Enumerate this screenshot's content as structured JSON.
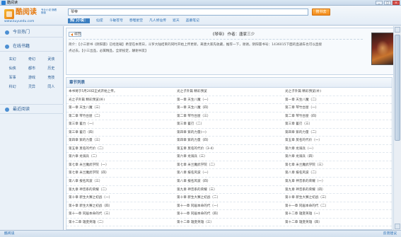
{
  "window": {
    "title": "酷阅读",
    "min": "_",
    "max": "□",
    "close": "×"
  },
  "header": {
    "logo": "酷阅读",
    "slogan": "专业小说 随看随读",
    "url": "www.kuyuedu.com",
    "search_value": "琴帝",
    "search_button": "搜书去",
    "hot_label": "热门小说：",
    "hot_links": [
      "仙逆",
      "斗破苍穹",
      "吞噬星空",
      "凡人修仙传",
      "遮天",
      "盗墓笔记"
    ]
  },
  "sidebar": {
    "hot": "今日热门",
    "online": "在线书籍",
    "genres": [
      "玄幻",
      "奇幻",
      "武侠",
      "仙侠",
      "都市",
      "历史",
      "军事",
      "游戏",
      "竞技",
      "科幻",
      "灵异",
      "同人"
    ],
    "recent": "最近阅读"
  },
  "book": {
    "back": "返回",
    "title_line": "《琴帝》   作者：唐家三少",
    "intro_lines": [
      "简介：【小三新书《阴阳寰》已经连载】希望在本周日，斗罗大陆结束的同时开始上传更新，来唐大家先收藏，推荐一下，谢谢。阴阳寰书号：1436015下面的直通车也可以直接",
      "点过去。【小三出品，必属精品，全新投定，酬谢书友】"
    ]
  },
  "chapters": {
    "header": "章节列表",
    "rows": [
      [
        "本书将于5月20日正式开始上传。",
        "光之子外篇 精彩预览",
        "光之子外篇 精彩预览(补)"
      ],
      [
        "光之子外篇 精彩预览(补)",
        "第一章 天生八魔（一）",
        "第一章 天生八魔（二）"
      ],
      [
        "第一章 天生八魔（三）",
        "第一章 天生八魔（四）",
        "第二章 琴竹台屋（一）"
      ],
      [
        "第二章 琴竹台屋（二）",
        "第二章 琴竹台屋（三）",
        "第二章 琴竹台屋（四）"
      ],
      [
        "第三章 蓄力（一）",
        "第三章 蓄刃（二）",
        "第三章 蓄刃（三）"
      ],
      [
        "第三章 蓄刃（四）",
        "第四章 紫的力量(一)",
        "第四章 紫的力量（二）"
      ],
      [
        "第四章 紫的力量（三）",
        "第四章 紫的力量（四）",
        "第五章 莫名的代价（一）"
      ],
      [
        "第五章 莫名的代价（二）",
        "第五章 莫名的代价（3-4）",
        "第六章 龙骑兵（一）"
      ],
      [
        "第六章 龙骑兵（二）",
        "第六章 龙骑兵（三）",
        "第六章 龙骑兵（四）"
      ],
      [
        "第七章 米兰魔武学院（一）",
        "第七章 米兰魔武学院（二）",
        "第七章 米兰魔武学院（三）"
      ],
      [
        "第七章 米兰魔武学院（四）",
        "第八章 报名风波（一）",
        "第八章 报名风波（二）"
      ],
      [
        "第八章 报名风波（三）",
        "第八章 报名风波（四）",
        "第九章 神音系的荣耀（一）"
      ],
      [
        "第九章 神音系的荣耀（二）",
        "第九章 神音系的荣耀（三）",
        "第九章 神音系的荣耀（四）"
      ],
      [
        "第十章 新生大赛之初战（一）",
        "第十章 新生大赛之初战（二）",
        "第十章 新生大赛之初战（三）"
      ],
      [
        "第十章 新生大赛之初战（四）",
        "第十一章 同居本命的代（一）",
        "第十一章 同居本命的代（二）"
      ],
      [
        "第十一章 同居本命的代（三）",
        "第十一章 同居本命的代（四）",
        "第十二章 雄变英雄（一）"
      ],
      [
        "第十二章 雄变英雄（二）",
        "第十二章 雄变英雄（三）",
        "第十二章 雄变英雄（四）"
      ]
    ]
  },
  "status": {
    "left": "酷阅读",
    "right": "反馈建议"
  }
}
